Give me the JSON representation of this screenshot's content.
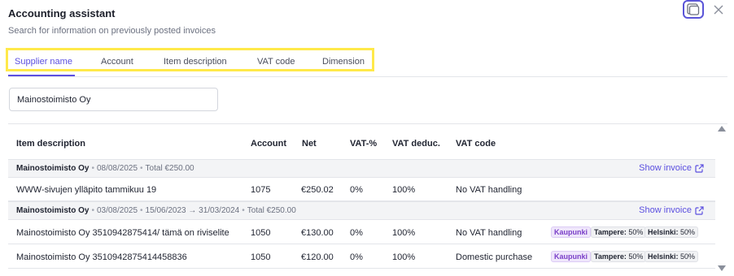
{
  "header": {
    "title": "Accounting assistant",
    "subtitle": "Search for information on previously posted invoices"
  },
  "tabs": [
    {
      "label": "Supplier name",
      "active": true
    },
    {
      "label": "Account",
      "active": false
    },
    {
      "label": "Item description",
      "active": false
    },
    {
      "label": "VAT code",
      "active": false
    },
    {
      "label": "Dimension",
      "active": false
    }
  ],
  "search": {
    "value": "Mainostoimisto Oy"
  },
  "table": {
    "columns": [
      "Item description",
      "Account",
      "Net",
      "VAT-%",
      "VAT deduc.",
      "VAT code"
    ],
    "groups": [
      {
        "supplier": "Mainostoimisto Oy",
        "meta": [
          "08/08/2025",
          "Total €250.00"
        ],
        "show_invoice": "Show invoice",
        "rows": [
          {
            "description": "WWW-sivujen ylläpito tammikuu 19",
            "account": "1075",
            "net": "€250.02",
            "vat_pct": "0%",
            "vat_deduc": "100%",
            "vat_code": "No VAT handling",
            "dimensions": []
          }
        ]
      },
      {
        "supplier": "Mainostoimisto Oy",
        "meta": [
          "03/08/2025",
          "15/06/2023 → 31/03/2024",
          "Total €250.00"
        ],
        "show_invoice": "Show invoice",
        "rows": [
          {
            "description": "Mainostoimisto Oy 3510942875414/ tämä on riviselite",
            "account": "1050",
            "net": "€130.00",
            "vat_pct": "0%",
            "vat_deduc": "100%",
            "vat_code": "No VAT handling",
            "dimensions": {
              "tag": "Kaupunki",
              "items": [
                {
                  "name": "Tampere:",
                  "value": "50%"
                },
                {
                  "name": "Helsinki:",
                  "value": "50%"
                }
              ]
            }
          },
          {
            "description": "Mainostoimisto Oy 3510942875414458836",
            "account": "1050",
            "net": "€120.00",
            "vat_pct": "0%",
            "vat_deduc": "100%",
            "vat_code": "Domestic purchase",
            "dimensions": {
              "tag": "Kaupunki",
              "items": [
                {
                  "name": "Tampere:",
                  "value": "50%"
                },
                {
                  "name": "Helsinki:",
                  "value": "50%"
                }
              ]
            }
          }
        ]
      }
    ]
  },
  "colors": {
    "accent": "#5b4fe0",
    "highlight_border": "#ffe94a",
    "dimension_tag": "#7a3fc8"
  },
  "icons": [
    "panel-toggle-icon",
    "close-icon",
    "external-link-icon",
    "scroll-up-icon",
    "scroll-down-icon"
  ]
}
